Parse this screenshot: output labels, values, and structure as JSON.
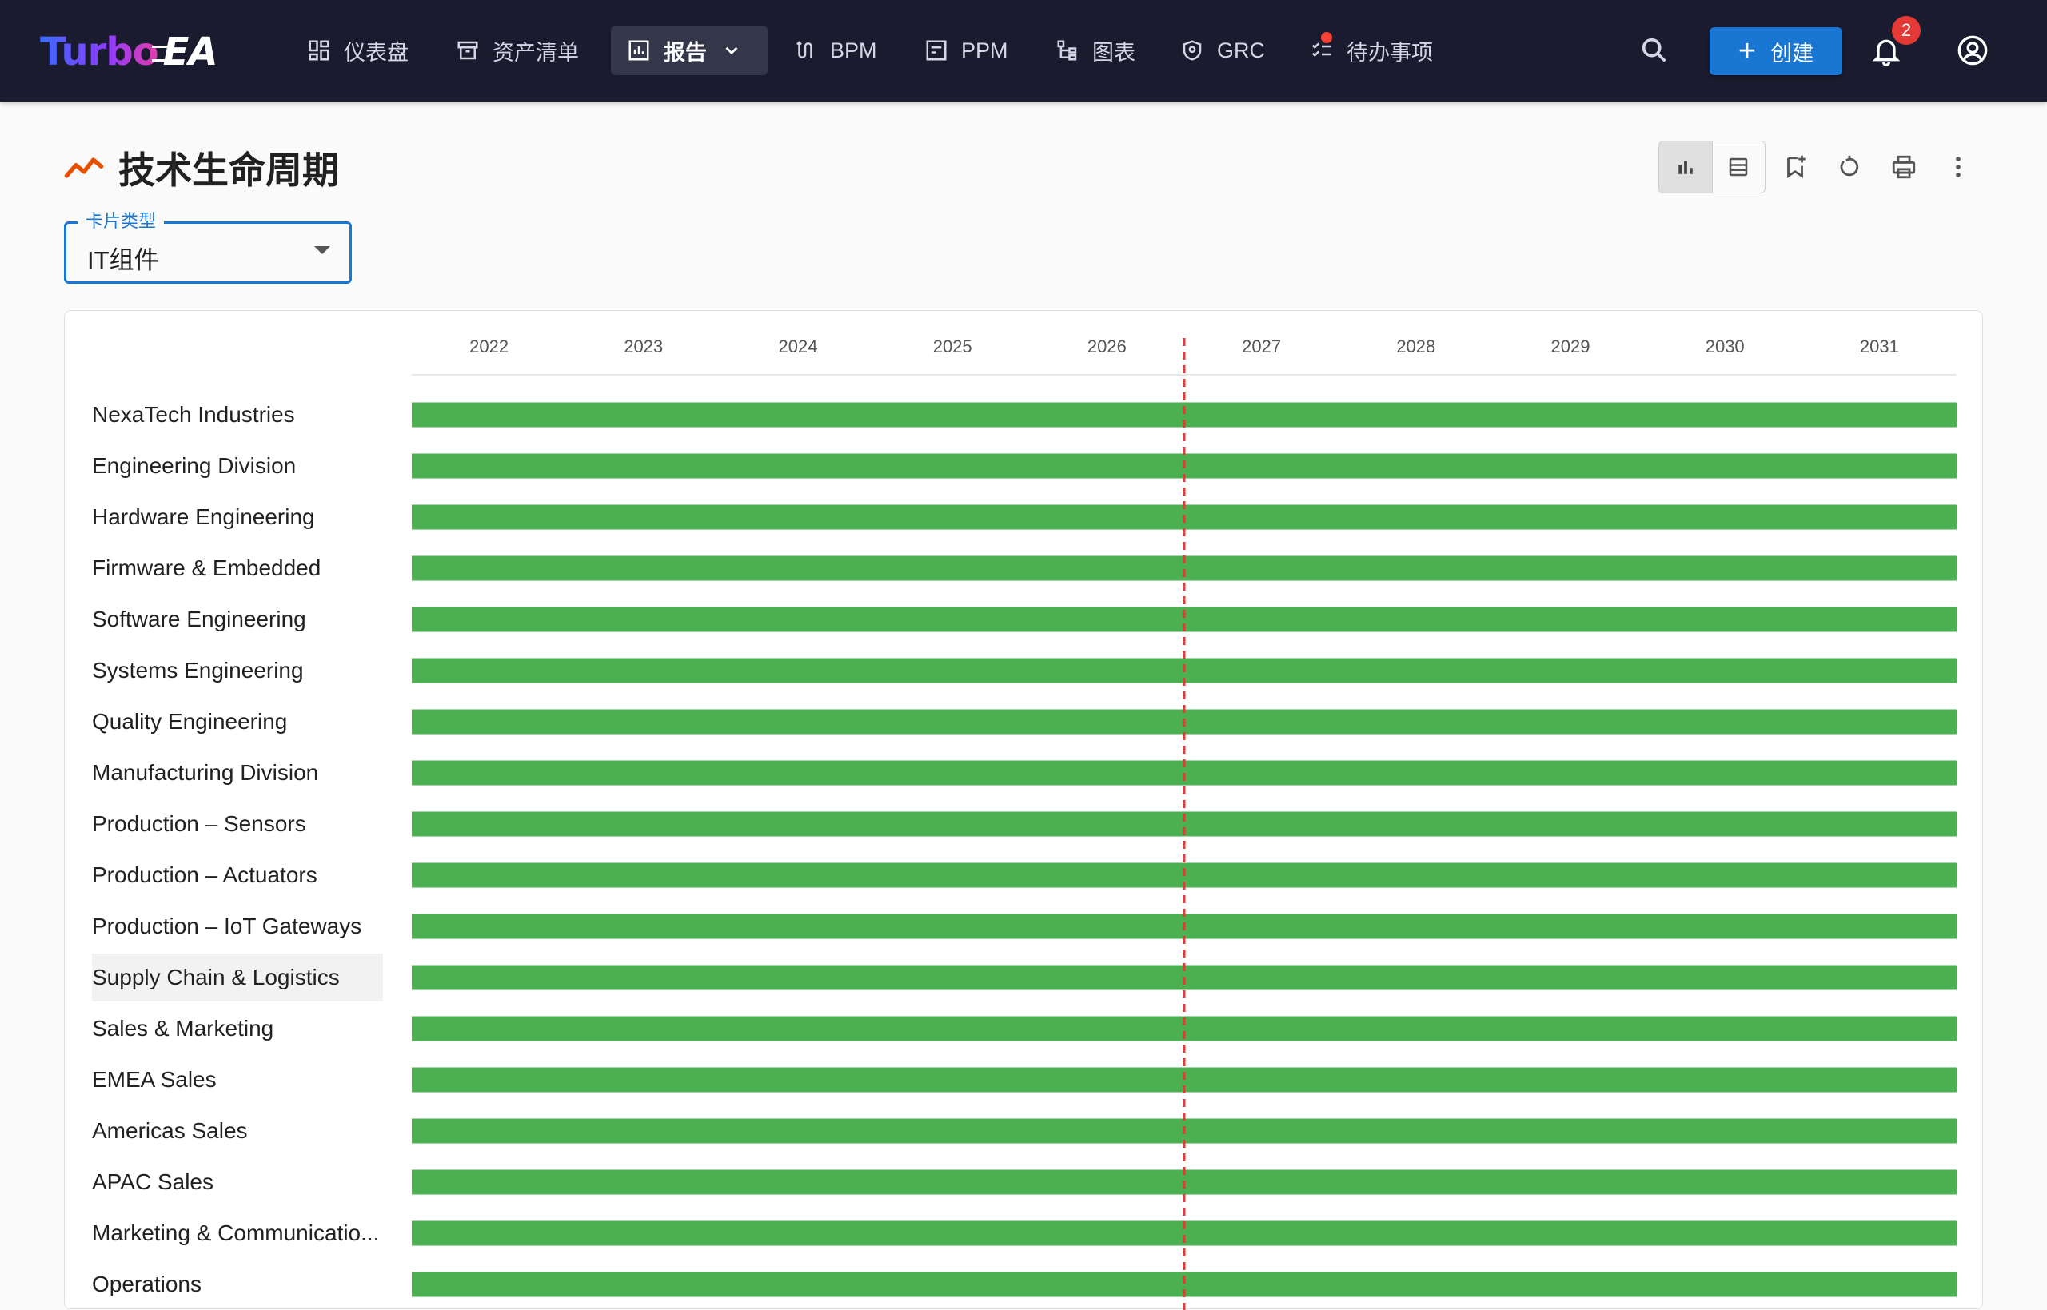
{
  "app": {
    "brand_turbo": "Turbo",
    "brand_ea": "EA"
  },
  "nav": {
    "items": [
      {
        "label": "仪表盘",
        "icon": "dashboard-icon",
        "active": false
      },
      {
        "label": "资产清单",
        "icon": "inventory-icon",
        "active": false
      },
      {
        "label": "报告",
        "icon": "report-icon",
        "active": true
      },
      {
        "label": "BPM",
        "icon": "bpm-icon",
        "active": false
      },
      {
        "label": "PPM",
        "icon": "ppm-icon",
        "active": false
      },
      {
        "label": "图表",
        "icon": "diagram-icon",
        "active": false
      },
      {
        "label": "GRC",
        "icon": "shield-icon",
        "active": false
      },
      {
        "label": "待办事项",
        "icon": "todo-icon",
        "active": false
      }
    ],
    "create_label": "创建",
    "notification_count": "2"
  },
  "page": {
    "title": "技术生命周期"
  },
  "filter": {
    "legend": "卡片类型",
    "value": "IT组件"
  },
  "colors": {
    "accent": "#1976d2",
    "bar": "#4caf50",
    "today_line": "#e53935",
    "nav_bg": "#1a1b2e"
  },
  "chart_data": {
    "type": "bar",
    "x_axis": [
      "2022",
      "2023",
      "2024",
      "2025",
      "2026",
      "2027",
      "2028",
      "2029",
      "2030",
      "2031"
    ],
    "today_marker": 2026.5,
    "rows": [
      {
        "label": "NexaTech Industries",
        "start": 2021.5,
        "end": 2031.5
      },
      {
        "label": "Engineering Division",
        "start": 2021.5,
        "end": 2031.5
      },
      {
        "label": "Hardware Engineering",
        "start": 2021.5,
        "end": 2031.5
      },
      {
        "label": "Firmware & Embedded",
        "start": 2021.5,
        "end": 2031.5
      },
      {
        "label": "Software Engineering",
        "start": 2021.5,
        "end": 2031.5
      },
      {
        "label": "Systems Engineering",
        "start": 2021.5,
        "end": 2031.5
      },
      {
        "label": "Quality Engineering",
        "start": 2021.5,
        "end": 2031.5
      },
      {
        "label": "Manufacturing Division",
        "start": 2021.5,
        "end": 2031.5
      },
      {
        "label": "Production – Sensors",
        "start": 2021.5,
        "end": 2031.5
      },
      {
        "label": "Production – Actuators",
        "start": 2021.5,
        "end": 2031.5
      },
      {
        "label": "Production – IoT Gateways",
        "start": 2021.5,
        "end": 2031.5
      },
      {
        "label": "Supply Chain & Logistics",
        "start": 2021.5,
        "end": 2031.5,
        "highlighted": true
      },
      {
        "label": "Sales & Marketing",
        "start": 2021.5,
        "end": 2031.5
      },
      {
        "label": "EMEA Sales",
        "start": 2021.5,
        "end": 2031.5
      },
      {
        "label": "Americas Sales",
        "start": 2021.5,
        "end": 2031.5
      },
      {
        "label": "APAC Sales",
        "start": 2021.5,
        "end": 2031.5
      },
      {
        "label": "Marketing & Communicatio...",
        "start": 2021.5,
        "end": 2031.5
      },
      {
        "label": "Operations",
        "start": 2021.5,
        "end": 2031.5
      }
    ]
  }
}
